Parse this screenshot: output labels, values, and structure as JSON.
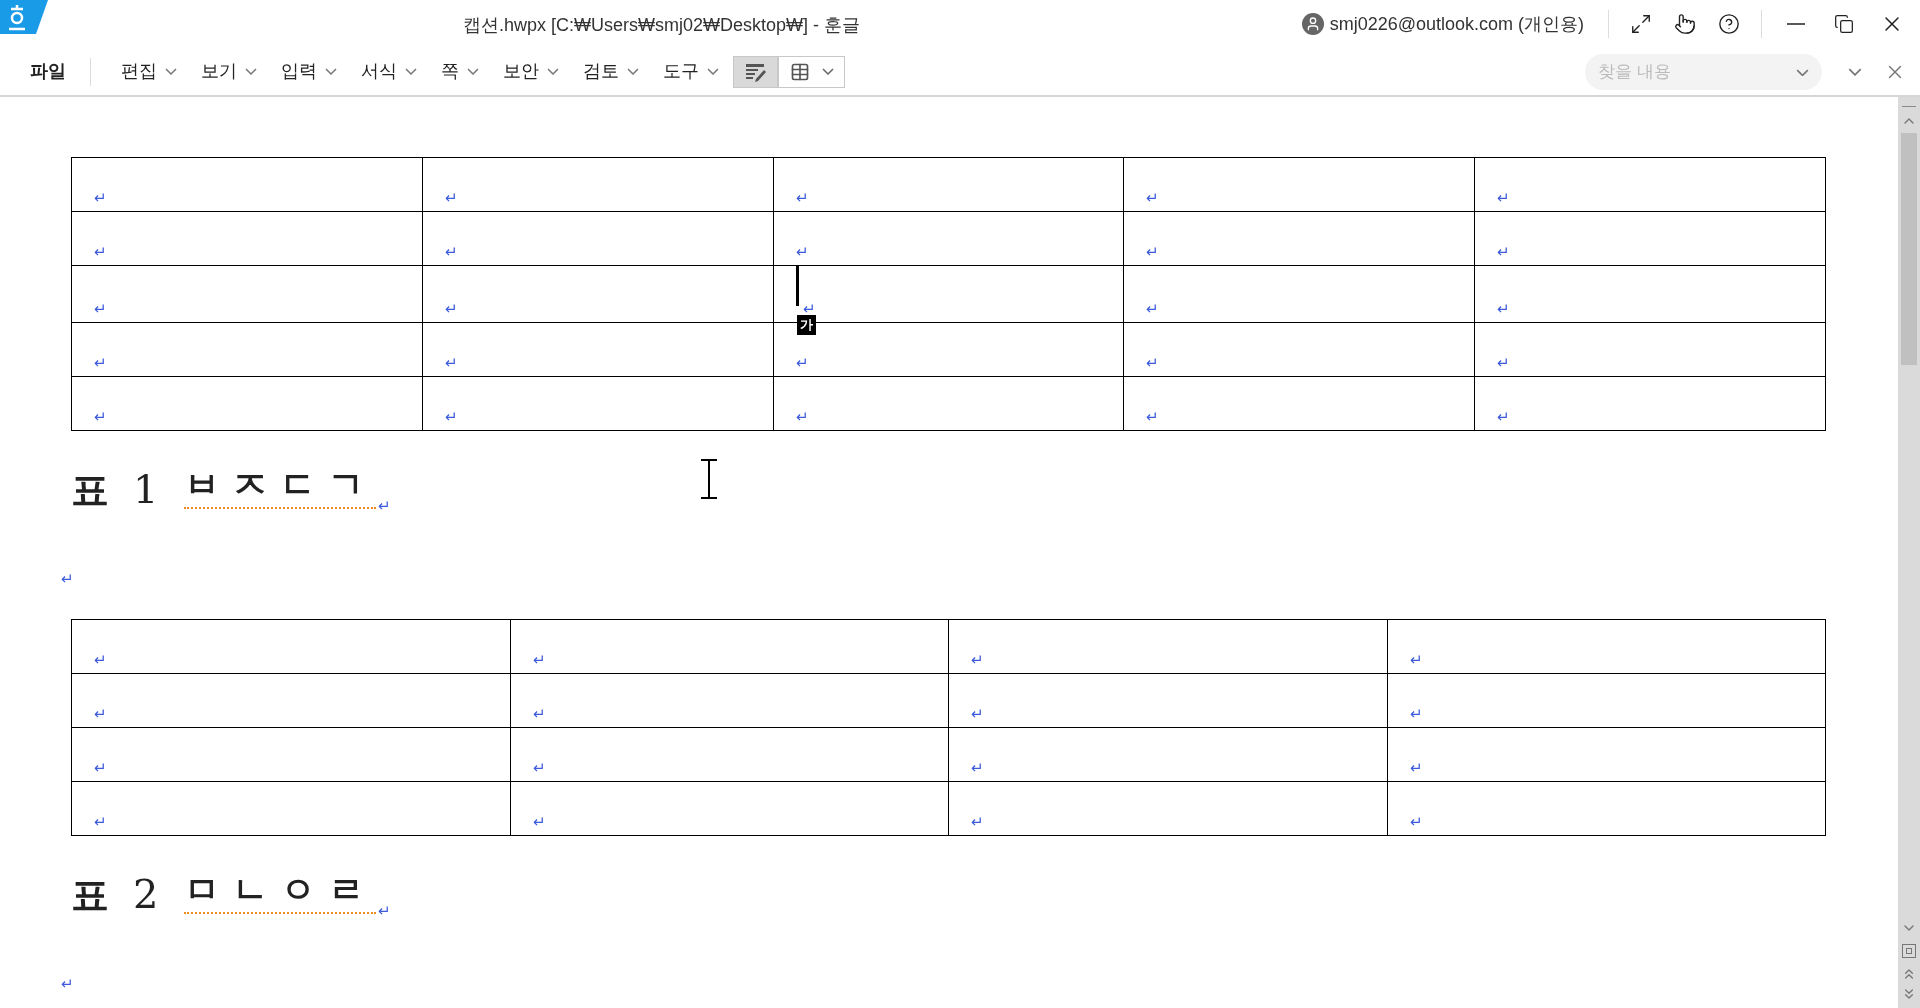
{
  "window": {
    "title": "캡션.hwpx [C:₩Users₩smj02₩Desktop₩] - 훈글",
    "account": "smj0226@outlook.com (개인용)"
  },
  "menu": [
    {
      "label": "파일",
      "dropdown": false
    },
    {
      "label": "편집",
      "dropdown": true
    },
    {
      "label": "보기",
      "dropdown": true
    },
    {
      "label": "입력",
      "dropdown": true
    },
    {
      "label": "서식",
      "dropdown": true
    },
    {
      "label": "쪽",
      "dropdown": true
    },
    {
      "label": "보안",
      "dropdown": true
    },
    {
      "label": "검토",
      "dropdown": true
    },
    {
      "label": "도구",
      "dropdown": true
    }
  ],
  "toolbar": [
    {
      "kind": "table-pen",
      "selected": true
    },
    {
      "kind": "table-grid",
      "selected": false
    }
  ],
  "search": {
    "placeholder": "찾을 내용"
  },
  "document": [
    {
      "kind": "table",
      "rows": [
        [
          {
            "text": "↵",
            "caret": false
          },
          {
            "text": "↵",
            "caret": false
          },
          {
            "text": "↵",
            "caret": false
          },
          {
            "text": "↵",
            "caret": false
          },
          {
            "text": "↵",
            "caret": false
          }
        ],
        [
          {
            "text": "↵",
            "caret": false
          },
          {
            "text": "↵",
            "caret": false
          },
          {
            "text": "↵",
            "caret": false
          },
          {
            "text": "↵",
            "caret": false
          },
          {
            "text": "↵",
            "caret": false
          }
        ],
        [
          {
            "text": "↵",
            "caret": false
          },
          {
            "text": "↵",
            "caret": false
          },
          {
            "text": "↵",
            "caret": true,
            "ime": "가"
          },
          {
            "text": "↵",
            "caret": false
          },
          {
            "text": "↵",
            "caret": false
          }
        ],
        [
          {
            "text": "↵",
            "caret": false
          },
          {
            "text": "↵",
            "caret": false
          },
          {
            "text": "↵",
            "caret": false
          },
          {
            "text": "↵",
            "caret": false
          },
          {
            "text": "↵",
            "caret": false
          }
        ],
        [
          {
            "text": "↵",
            "caret": false
          },
          {
            "text": "↵",
            "caret": false
          },
          {
            "text": "↵",
            "caret": false
          },
          {
            "text": "↵",
            "caret": false
          },
          {
            "text": "↵",
            "caret": false
          }
        ]
      ]
    },
    {
      "kind": "caption",
      "label": "표",
      "number": "1",
      "text": "ㅂㅈㄷㄱ",
      "mark": "↵",
      "spell_error": true,
      "mouse_cursor": true
    },
    {
      "kind": "paragraph",
      "mark": "↵"
    },
    {
      "kind": "table",
      "rows": [
        [
          {
            "text": "↵",
            "caret": false
          },
          {
            "text": "↵",
            "caret": false
          },
          {
            "text": "↵",
            "caret": false
          },
          {
            "text": "↵",
            "caret": false
          }
        ],
        [
          {
            "text": "↵",
            "caret": false
          },
          {
            "text": "↵",
            "caret": false
          },
          {
            "text": "↵",
            "caret": false
          },
          {
            "text": "↵",
            "caret": false
          }
        ],
        [
          {
            "text": "↵",
            "caret": false
          },
          {
            "text": "↵",
            "caret": false
          },
          {
            "text": "↵",
            "caret": false
          },
          {
            "text": "↵",
            "caret": false
          }
        ],
        [
          {
            "text": "↵",
            "caret": false
          },
          {
            "text": "↵",
            "caret": false
          },
          {
            "text": "↵",
            "caret": false
          },
          {
            "text": "↵",
            "caret": false
          }
        ]
      ]
    },
    {
      "kind": "caption",
      "label": "표",
      "number": "2",
      "text": "ㅁㄴㅇㄹ",
      "mark": "↵",
      "spell_error": true,
      "mouse_cursor": false
    },
    {
      "kind": "paragraph",
      "mark": "↵"
    }
  ]
}
